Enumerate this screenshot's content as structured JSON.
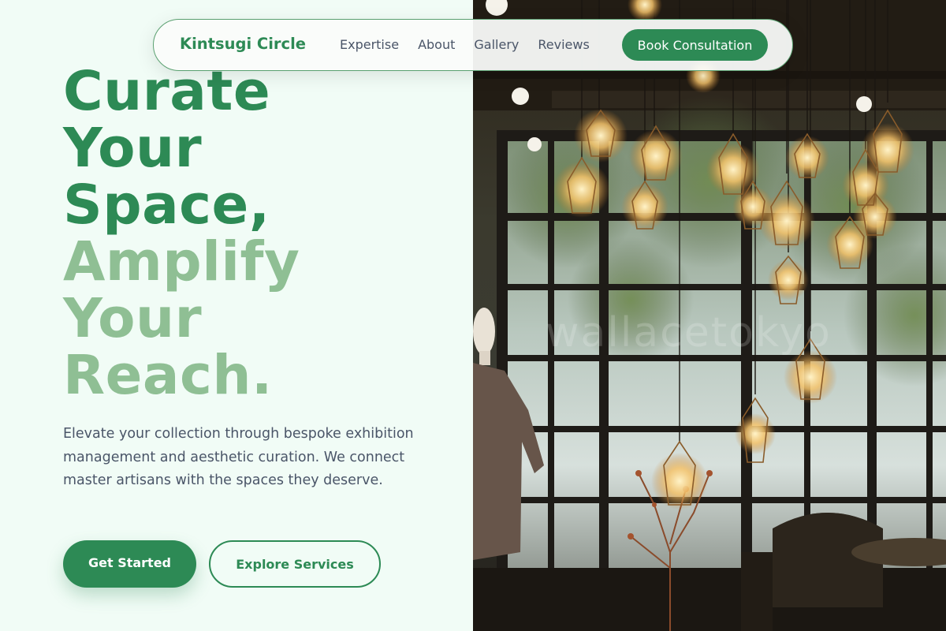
{
  "nav": {
    "brand": "Kintsugi Circle",
    "links": [
      "Expertise",
      "About",
      "Gallery",
      "Reviews"
    ],
    "cta": "Book Consultation"
  },
  "hero": {
    "headline_dark": [
      "Curate",
      "Your",
      "Space,"
    ],
    "headline_light": [
      "Amplify",
      "Your",
      "Reach."
    ],
    "description": "Elevate your collection through bespoke exhibition management and aesthetic curation. We connect master artisans with the spaces they deserve.",
    "primary_button": "Get Started",
    "secondary_button": "Explore Services"
  },
  "photo": {
    "watermark": "wallacetokyo"
  },
  "colors": {
    "brand_green": "#2d8a55",
    "light_green": "#8fbf94",
    "background": "#f1fcf6",
    "body_text": "#4a5568"
  }
}
